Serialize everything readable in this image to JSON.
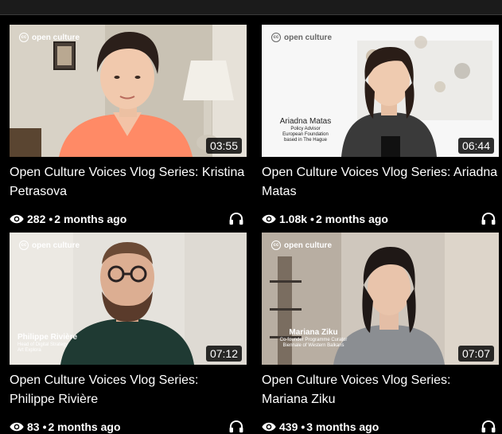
{
  "brand": {
    "name": "open culture",
    "cc_mark": "cc"
  },
  "icons": {
    "views": "eye-icon",
    "audio": "headphones-icon"
  },
  "videos": [
    {
      "title": "Open Culture Voices Vlog Series: Kristina Petrasova",
      "duration": "03:55",
      "views": "282",
      "age": "2 months ago",
      "name_caption": "",
      "role_caption": []
    },
    {
      "title": "Open Culture Voices Vlog Series: Ariadna Matas",
      "duration": "06:44",
      "views": "1.08k",
      "age": "2 months ago",
      "name_caption": "Ariadna Matas",
      "role_caption": [
        "Policy Advisor",
        "European Foundation",
        "based in The Hague"
      ]
    },
    {
      "title": "Open Culture Voices Vlog Series: Philippe Rivière",
      "duration": "07:12",
      "views": "83",
      "age": "2 months ago",
      "name_caption": "Philippe Rivière",
      "role_caption": [
        "Head of Digital Strategy",
        "Art Explora"
      ]
    },
    {
      "title": "Open Culture Voices Vlog Series: Mariana Ziku",
      "duration": "07:07",
      "views": "439",
      "age": "3 months ago",
      "name_caption": "Mariana Ziku",
      "role_caption": [
        "Co-founder Programme Curator",
        "Biennale of Western Balkans"
      ]
    }
  ]
}
